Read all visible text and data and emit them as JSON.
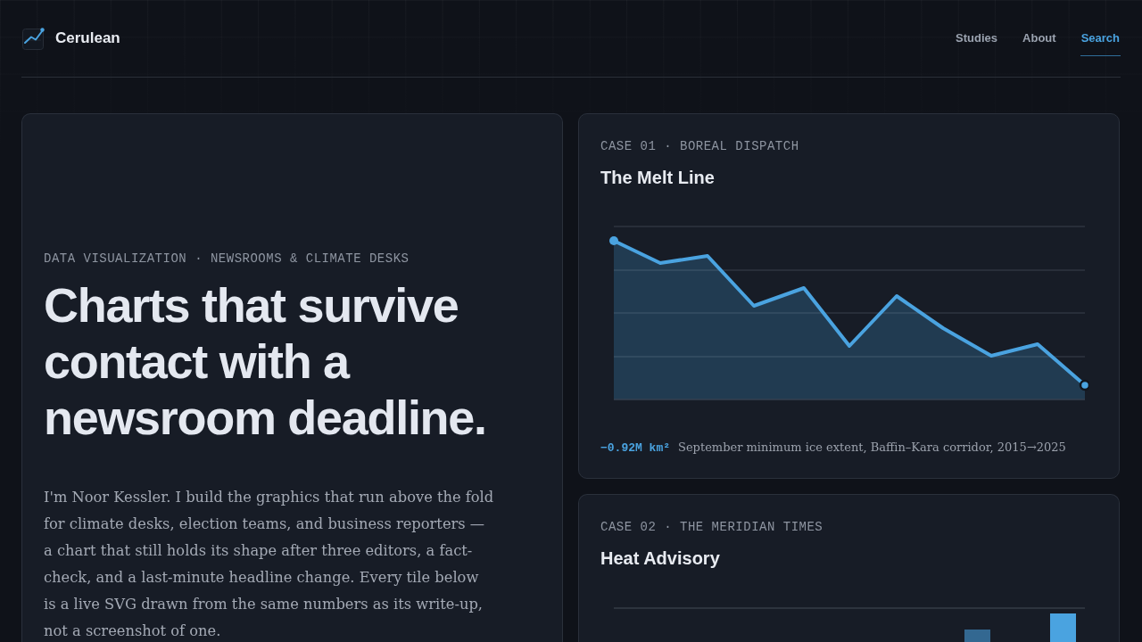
{
  "brand": {
    "name": "Cerulean"
  },
  "nav": [
    {
      "label": "Studies",
      "selected": false
    },
    {
      "label": "About",
      "selected": false
    },
    {
      "label": "Search",
      "selected": true
    }
  ],
  "hero": {
    "eyebrow": "DATA VISUALIZATION · NEWSROOMS & CLIMATE DESKS",
    "heading": "Charts that survive contact with a newsroom deadline.",
    "body": "I'm Noor Kessler. I build the graphics that run above the fold for climate desks, election teams, and business reporters — a chart that still holds its shape after three editors, a fact-check, and a last-minute headline change. Every tile below is a live SVG drawn from the same numbers as its write-up, not a screenshot of one."
  },
  "cases": [
    {
      "kind": "area",
      "eyebrow": "CASE 01 · BOREAL DISPATCH",
      "title": "The Melt Line",
      "stat": "−0.92M km²",
      "caption": "September minimum ice extent, Baffin–Kara corridor, 2015→2025"
    },
    {
      "kind": "bar",
      "eyebrow": "CASE 02 · THE MERIDIAN TIMES",
      "title": "Heat Advisory"
    }
  ]
}
